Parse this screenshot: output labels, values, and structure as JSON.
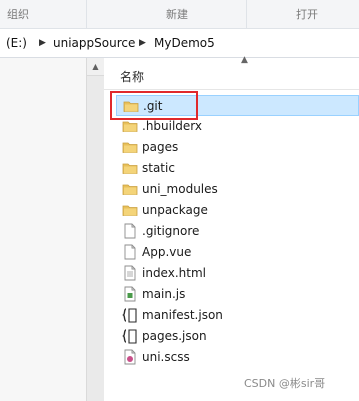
{
  "toolbar": {
    "items": [
      "组织",
      "新建",
      "打开"
    ]
  },
  "address_bar": {
    "segments": [
      "(E:)",
      "uniappSource",
      "MyDemo5"
    ]
  },
  "file_list": {
    "column_header": "名称",
    "items": [
      {
        "name": ".git",
        "icon": "folder-icon",
        "selected": true
      },
      {
        "name": ".hbuilderx",
        "icon": "folder-icon"
      },
      {
        "name": "pages",
        "icon": "folder-icon"
      },
      {
        "name": "static",
        "icon": "folder-icon"
      },
      {
        "name": "uni_modules",
        "icon": "folder-icon"
      },
      {
        "name": "unpackage",
        "icon": "folder-icon"
      },
      {
        "name": ".gitignore",
        "icon": "file-icon"
      },
      {
        "name": "App.vue",
        "icon": "file-icon"
      },
      {
        "name": "index.html",
        "icon": "html-file-icon"
      },
      {
        "name": "main.js",
        "icon": "js-file-icon"
      },
      {
        "name": "manifest.json",
        "icon": "json-file-icon"
      },
      {
        "name": "pages.json",
        "icon": "json-file-icon"
      },
      {
        "name": "uni.scss",
        "icon": "scss-file-icon"
      }
    ]
  },
  "watermark": "CSDN @彬sir哥",
  "colors": {
    "selection": "#cce8ff",
    "highlight_box": "#e0292b",
    "folder": "#e8c05a"
  }
}
